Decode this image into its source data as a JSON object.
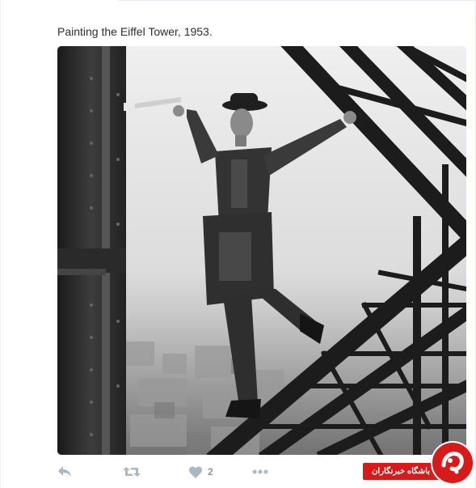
{
  "tweet": {
    "text": "Painting the Eiffel Tower, 1953."
  },
  "photo": {
    "description_icon": "photo-image"
  },
  "actions": {
    "reply_icon": "reply-icon",
    "retweet_icon": "retweet-icon",
    "like_icon": "heart-icon",
    "like_count": "2",
    "more_icon": "more-icon"
  },
  "watermark": {
    "label": "باشگاه خبرنگاران",
    "color": "#d71a1a"
  },
  "colors": {
    "text": "#292f33",
    "action_icon": "#aab8c2",
    "divider": "#e6ecf0"
  }
}
